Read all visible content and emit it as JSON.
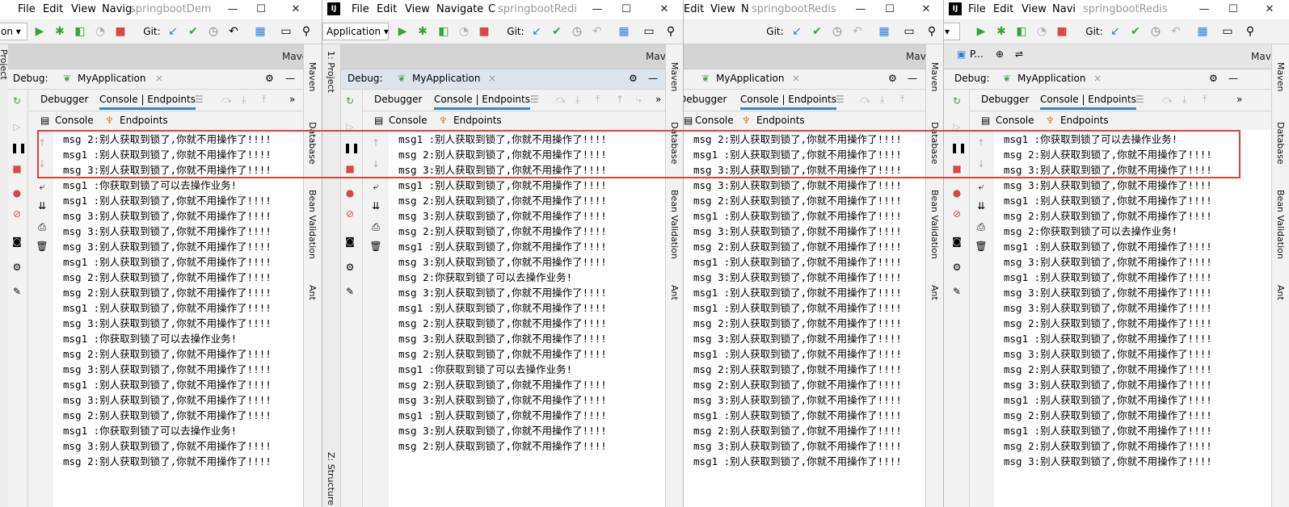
{
  "windows": [
    {
      "menus": [
        "File",
        "Edit",
        "View",
        "Navig"
      ],
      "title": "springbootDem",
      "config_label": "on",
      "maven_label": "Mave",
      "debug_label": "Debug:",
      "run_tab": "MyApplication",
      "tabs": [
        "Debugger",
        "Console | Endpoints"
      ],
      "subtabs": [
        "Console",
        "Endpoints"
      ],
      "right_tools": [
        "Maven",
        "Database",
        "Bean Validation",
        "Ant"
      ],
      "left_tools": [
        "Project"
      ],
      "lines": [
        "msg 2:别人获取到锁了,你就不用操作了!!!!",
        "msg1 :别人获取到锁了,你就不用操作了!!!!",
        "msg 3:别人获取到锁了,你就不用操作了!!!!",
        "msg1 :你获取到锁了可以去操作业务!",
        "msg1 :别人获取到锁了,你就不用操作了!!!!",
        "msg 3:别人获取到锁了,你就不用操作了!!!!",
        "msg 3:别人获取到锁了,你就不用操作了!!!!",
        "msg 3:别人获取到锁了,你就不用操作了!!!!",
        "msg1 :别人获取到锁了,你就不用操作了!!!!",
        "msg 2:别人获取到锁了,你就不用操作了!!!!",
        "msg 2:别人获取到锁了,你就不用操作了!!!!",
        "msg1 :别人获取到锁了,你就不用操作了!!!!",
        "msg 3:别人获取到锁了,你就不用操作了!!!!",
        "msg1 :你获取到锁了可以去操作业务!",
        "msg 2:别人获取到锁了,你就不用操作了!!!!",
        "msg 3:别人获取到锁了,你就不用操作了!!!!",
        "msg1 :别人获取到锁了,你就不用操作了!!!!",
        "msg 3:别人获取到锁了,你就不用操作了!!!!",
        "msg 2:别人获取到锁了,你就不用操作了!!!!",
        "msg1 :你获取到锁了可以去操作业务!",
        "msg 3:别人获取到锁了,你就不用操作了!!!!",
        "msg 2:别人获取到锁了,你就不用操作了!!!!"
      ]
    },
    {
      "menus": [
        "File",
        "Edit",
        "View",
        "Navigate",
        "C"
      ],
      "title": "springbootRedi",
      "config_label": "Application",
      "maven_label": "Mave",
      "debug_label": "Debug:",
      "run_tab": "MyApplication",
      "tabs": [
        "Debugger",
        "Console | Endpoints"
      ],
      "subtabs": [
        "Console",
        "Endpoints"
      ],
      "right_tools": [
        "Maven",
        "Database",
        "Bean Validation",
        "Ant"
      ],
      "left_tools": [
        "1: Project",
        "Z: Structure"
      ],
      "lines": [
        "msg1 :别人获取到锁了,你就不用操作了!!!!",
        "msg 2:别人获取到锁了,你就不用操作了!!!!",
        "msg 3:别人获取到锁了,你就不用操作了!!!!",
        "msg1 :别人获取到锁了,你就不用操作了!!!!",
        "msg 2:别人获取到锁了,你就不用操作了!!!!",
        "msg 3:别人获取到锁了,你就不用操作了!!!!",
        "msg 2:别人获取到锁了,你就不用操作了!!!!",
        "msg1 :别人获取到锁了,你就不用操作了!!!!",
        "msg 3:别人获取到锁了,你就不用操作了!!!!",
        "msg 2:你获取到锁了可以去操作业务!",
        "msg 3:别人获取到锁了,你就不用操作了!!!!",
        "msg1 :别人获取到锁了,你就不用操作了!!!!",
        "msg 2:别人获取到锁了,你就不用操作了!!!!",
        "msg 3:别人获取到锁了,你就不用操作了!!!!",
        "msg 2:别人获取到锁了,你就不用操作了!!!!",
        "msg1 :你获取到锁了可以去操作业务!",
        "msg 2:别人获取到锁了,你就不用操作了!!!!",
        "msg 3:别人获取到锁了,你就不用操作了!!!!",
        "msg1 :别人获取到锁了,你就不用操作了!!!!",
        "msg 3:别人获取到锁了,你就不用操作了!!!!",
        "msg 2:别人获取到锁了,你就不用操作了!!!!"
      ]
    },
    {
      "menus": [
        "Edit",
        "View",
        "N"
      ],
      "title": "springbootRedis",
      "config_label": "",
      "maven_label": "Mave",
      "debug_label": "",
      "run_tab": "MyApplication",
      "tabs": [
        "Debugger",
        "Console | Endpoints"
      ],
      "subtabs": [
        "Console",
        "Endpoints"
      ],
      "right_tools": [
        "Maven",
        "Database",
        "Bean Validation",
        "Ant"
      ],
      "left_tools": [],
      "lines": [
        "msg 2:别人获取到锁了,你就不用操作了!!!!",
        "msg1 :别人获取到锁了,你就不用操作了!!!!",
        "msg 3:别人获取到锁了,你就不用操作了!!!!",
        "msg 3:别人获取到锁了,你就不用操作了!!!!",
        "msg 2:别人获取到锁了,你就不用操作了!!!!",
        "msg1 :别人获取到锁了,你就不用操作了!!!!",
        "msg 3:别人获取到锁了,你就不用操作了!!!!",
        "msg 2:别人获取到锁了,你就不用操作了!!!!",
        "msg1 :别人获取到锁了,你就不用操作了!!!!",
        "msg 3:别人获取到锁了,你就不用操作了!!!!",
        "msg1 :别人获取到锁了,你就不用操作了!!!!",
        "msg1 :别人获取到锁了,你就不用操作了!!!!",
        "msg 2:别人获取到锁了,你就不用操作了!!!!",
        "msg 3:别人获取到锁了,你就不用操作了!!!!",
        "msg1 :别人获取到锁了,你就不用操作了!!!!",
        "msg 2:别人获取到锁了,你就不用操作了!!!!",
        "msg 2:别人获取到锁了,你就不用操作了!!!!",
        "msg 3:别人获取到锁了,你就不用操作了!!!!",
        "msg1 :别人获取到锁了,你就不用操作了!!!!",
        "msg 2:别人获取到锁了,你就不用操作了!!!!",
        "msg 3:别人获取到锁了,你就不用操作了!!!!",
        "msg1 :别人获取到锁了,你就不用操作了!!!!"
      ]
    },
    {
      "menus": [
        "File",
        "Edit",
        "View",
        "Navi"
      ],
      "title": "springbootRedis",
      "config_label": "",
      "maven_label": "Mave",
      "project_tab": "P...",
      "debug_label": "Debug:",
      "run_tab": "MyApplication",
      "tabs": [
        "Debugger",
        "Console | Endpoints"
      ],
      "subtabs": [
        "Console",
        "Endpoints"
      ],
      "right_tools": [
        "Maven",
        "Database",
        "Bean Validation",
        "Ant"
      ],
      "left_tools": [],
      "lines": [
        "msg1 :你获取到锁了可以去操作业务!",
        "msg 2:别人获取到锁了,你就不用操作了!!!!",
        "msg 3:别人获取到锁了,你就不用操作了!!!!",
        "msg 3:别人获取到锁了,你就不用操作了!!!!",
        "msg1 :别人获取到锁了,你就不用操作了!!!!",
        "msg 2:别人获取到锁了,你就不用操作了!!!!",
        "msg 2:你获取到锁了可以去操作业务!",
        "msg1 :别人获取到锁了,你就不用操作了!!!!",
        "msg 3:别人获取到锁了,你就不用操作了!!!!",
        "msg1 :别人获取到锁了,你就不用操作了!!!!",
        "msg 3:别人获取到锁了,你就不用操作了!!!!",
        "msg 3:别人获取到锁了,你就不用操作了!!!!",
        "msg 2:别人获取到锁了,你就不用操作了!!!!",
        "msg1 :别人获取到锁了,你就不用操作了!!!!",
        "msg 3:别人获取到锁了,你就不用操作了!!!!",
        "msg 2:别人获取到锁了,你就不用操作了!!!!",
        "msg 3:别人获取到锁了,你就不用操作了!!!!",
        "msg1 :别人获取到锁了,你就不用操作了!!!!",
        "msg 2:别人获取到锁了,你就不用操作了!!!!",
        "msg1 :别人获取到锁了,你就不用操作了!!!!",
        "msg 2:别人获取到锁了,你就不用操作了!!!!",
        "msg 3:别人获取到锁了,你就不用操作了!!!!"
      ]
    }
  ],
  "highlight_color": "#e0403a",
  "accent_color": "#4083c9",
  "icons": {
    "run": "run-icon",
    "debug": "debug-icon",
    "stop": "stop-icon",
    "git_update": "git-update-icon",
    "git_commit": "git-commit-icon",
    "search": "search-icon",
    "settings": "gear-icon",
    "minimize": "minimize-icon"
  }
}
